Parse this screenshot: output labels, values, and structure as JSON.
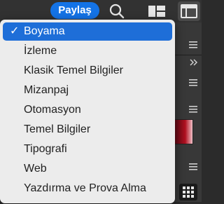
{
  "toolbar": {
    "share_label": "Paylaş",
    "accent_color": "#1473e6"
  },
  "workspace_menu": {
    "check_mark": "✓",
    "items": [
      {
        "label": "Boyama",
        "selected": true
      },
      {
        "label": "İzleme",
        "selected": false
      },
      {
        "label": "Klasik Temel Bilgiler",
        "selected": false
      },
      {
        "label": "Mizanpaj",
        "selected": false
      },
      {
        "label": "Otomasyon",
        "selected": false
      },
      {
        "label": "Temel Bilgiler",
        "selected": false
      },
      {
        "label": "Tipografi",
        "selected": false
      },
      {
        "label": "Web",
        "selected": false
      },
      {
        "label": "Yazdırma ve Prova Alma",
        "selected": false
      }
    ],
    "selected_color": "#1e6ed8"
  },
  "icons": {
    "search": "search-icon",
    "workspace": "workspace-switcher-icon",
    "panel": "panel-toggle-icon",
    "panel_menu": "panel-menu-icon",
    "collapse": "collapse-chevrons-icon",
    "grid": "grid-icon"
  }
}
